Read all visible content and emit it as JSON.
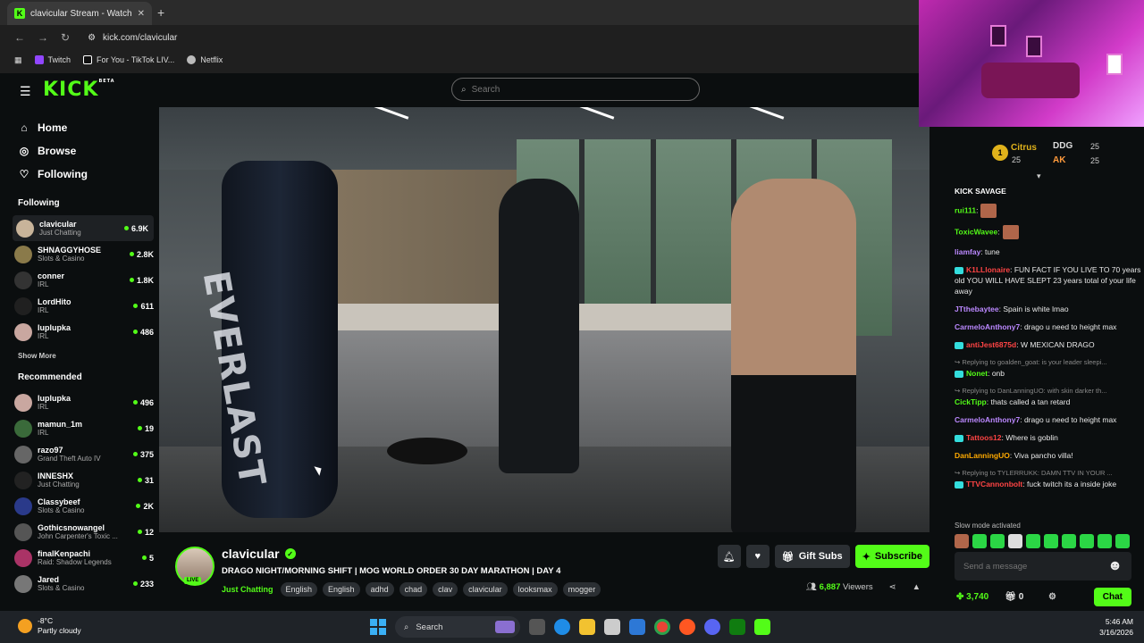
{
  "browser": {
    "tab_title": "clavicular Stream - Watch Live o",
    "tab_close": "✕",
    "new_tab": "+",
    "url": "kick.com/clavicular",
    "bookmarks": [
      {
        "label": "Twitch",
        "icon": "twitch-icon",
        "color": "#9146ff"
      },
      {
        "label": "For You - TikTok LIV...",
        "icon": "tiktok-icon",
        "color": "#ffffff"
      },
      {
        "label": "Netflix",
        "icon": "globe-icon",
        "color": "#bbbbbb"
      }
    ]
  },
  "site": {
    "logo": "KICK",
    "logo_beta": "BETA",
    "search_placeholder": "Search",
    "nav": [
      {
        "label": "Home",
        "icon": "home-icon"
      },
      {
        "label": "Browse",
        "icon": "browse-icon"
      },
      {
        "label": "Following",
        "icon": "heart-icon"
      }
    ],
    "following_title": "Following",
    "following": [
      {
        "name": "clavicular",
        "category": "Just Chatting",
        "viewers": "6.9K",
        "color": "#c8b49a"
      },
      {
        "name": "SHNAGGYHOSE",
        "category": "Slots & Casino",
        "viewers": "2.8K",
        "color": "#8a7a4a"
      },
      {
        "name": "conner",
        "category": "IRL",
        "viewers": "1.8K",
        "color": "#333333"
      },
      {
        "name": "LordHito",
        "category": "IRL",
        "viewers": "611",
        "color": "#202020"
      },
      {
        "name": "luplupka",
        "category": "IRL",
        "viewers": "486",
        "color": "#c9a7a0"
      }
    ],
    "show_more": "Show More",
    "recommended_title": "Recommended",
    "recommended": [
      {
        "name": "luplupka",
        "category": "IRL",
        "viewers": "496",
        "color": "#c9a7a0"
      },
      {
        "name": "mamun_1m",
        "category": "IRL",
        "viewers": "19",
        "color": "#3a6a3a"
      },
      {
        "name": "razo97",
        "category": "Grand Theft Auto IV",
        "viewers": "375",
        "color": "#666666"
      },
      {
        "name": "INNESHX",
        "category": "Just Chatting",
        "viewers": "31",
        "color": "#222222"
      },
      {
        "name": "Classybeef",
        "category": "Slots & Casino",
        "viewers": "2K",
        "color": "#2a3a8a"
      },
      {
        "name": "Gothicsnowangel",
        "category": "John Carpenter's Toxic ...",
        "viewers": "12",
        "color": "#555555"
      },
      {
        "name": "finalKenpachi",
        "category": "Raid: Shadow Legends",
        "viewers": "5",
        "color": "#aa3366"
      },
      {
        "name": "Jared",
        "category": "Slots & Casino",
        "viewers": "233",
        "color": "#777777"
      }
    ]
  },
  "stream": {
    "streamer": "clavicular",
    "live_badge": "LIVE",
    "title": "DRAGO NIGHT/MORNING SHIFT | MOG WORLD ORDER 30 DAY MARATHON | DAY 4",
    "category": "Just Chatting",
    "tags": [
      "English",
      "English",
      "adhd",
      "chad",
      "clav",
      "clavicular",
      "looksmax",
      "mogger"
    ],
    "gift_label": "Gift Subs",
    "subscribe_label": "Subscribe",
    "viewers_count": "6,887",
    "viewers_label": "Viewers",
    "bag_brand": "EVERLAST"
  },
  "chat": {
    "leaderboard": {
      "rank": "1",
      "first": {
        "name": "Citrus",
        "subs": "25"
      },
      "second": {
        "name": "DDG",
        "subs": "25"
      },
      "third": {
        "name": "AK",
        "subs": "25"
      }
    },
    "messages": [
      {
        "reply": "",
        "user": "KICK SAVAGE",
        "text": "",
        "color": "#ffffff"
      },
      {
        "reply": "",
        "user": "rui111",
        "text": ":",
        "color": "#53fc18"
      },
      {
        "reply": "",
        "user": "ToxicWavee",
        "text": ":",
        "color": "#53fc18"
      },
      {
        "reply": "",
        "user": "liamfay",
        "text": ": tune",
        "color": "#bb88ff"
      },
      {
        "reply": "",
        "user": "K1LLlonaire",
        "text": ": FUN FACT IF YOU LIVE TO 70 years old YOU WILL HAVE SLEPT 23 years total of your life away",
        "color": "#ff4444"
      },
      {
        "reply": "",
        "user": "JTthebaytee",
        "text": ": Spain is white lmao",
        "color": "#bb88ff"
      },
      {
        "reply": "",
        "user": "CarmeloAnthony7",
        "text": ": drago u need to height max",
        "color": "#bb88ff"
      },
      {
        "reply": "",
        "user": "antiJest6875d",
        "text": ": W MEXICAN DRAGO",
        "color": "#ff4444"
      },
      {
        "reply": "Replying to goalden_goat: is your leader sleepi...",
        "user": "Nonet",
        "text": ": onb",
        "color": "#53fc18"
      },
      {
        "reply": "Replying to DanLanningUO: with skin darker th...",
        "user": "CickTipp",
        "text": ": thats called a tan retard",
        "color": "#53fc18"
      },
      {
        "reply": "",
        "user": "CarmeloAnthony7",
        "text": ": drago u need to height max",
        "color": "#bb88ff"
      },
      {
        "reply": "",
        "user": "Tattoos12",
        "text": ": Where is goblin",
        "color": "#ff4444"
      },
      {
        "reply": "",
        "user": "DanLanningUO",
        "text": ": Viva pancho villa!",
        "color": "#ffaa00"
      },
      {
        "reply": "Replying to TYLERRUKK: DAMN TTV IN YOUR ...",
        "user": "TTVCannonbolt",
        "text": ": fuck twitch its a inside joke",
        "color": "#ff4444"
      }
    ],
    "slow_mode": "Slow mode activated",
    "input_placeholder": "Send a message",
    "points": "3,740",
    "gifts": "0",
    "send_label": "Chat"
  },
  "taskbar": {
    "temp": "-8°C",
    "weather": "Partly cloudy",
    "search": "Search",
    "time": "5:46 AM",
    "date": "3/16/2026"
  }
}
